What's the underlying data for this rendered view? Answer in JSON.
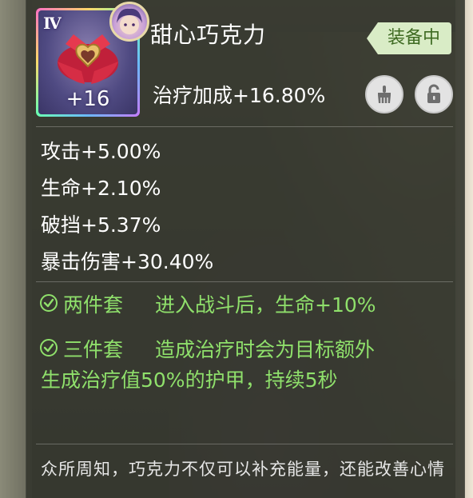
{
  "item": {
    "tier": "Ⅳ",
    "level": "+16",
    "title": "甜心巧克力",
    "equip_status": "装备中",
    "main_stat": "治疗加成+16.80%"
  },
  "sub_stats": [
    "攻击+5.00%",
    "生命+2.10%",
    "破挡+5.37%",
    "暴击伤害+30.40%"
  ],
  "sets": [
    {
      "name": "两件套",
      "desc": "进入战斗后，生命+10%"
    },
    {
      "name": "三件套",
      "desc": "造成治疗时会为目标额外",
      "desc_line2": "生成治疗值50%的护甲，持续5秒"
    }
  ],
  "flavor_text": "众所周知，巧克力不仅可以补充能量，还能改善心情",
  "icons": {
    "brush": "brush-icon",
    "lock": "unlock-icon",
    "check": "check-circle-icon"
  },
  "colors": {
    "set_green": "#8fe06b",
    "equip_tag_bg": "#d9ecc6",
    "equip_tag_text": "#3f6b23"
  }
}
